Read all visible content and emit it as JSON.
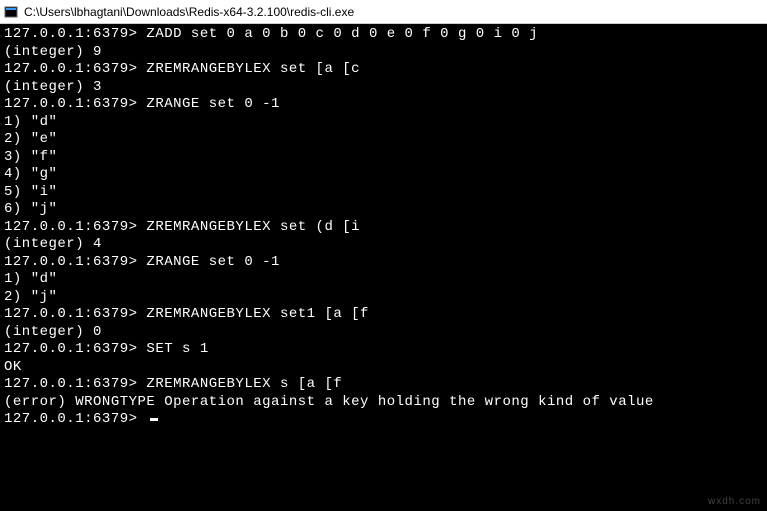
{
  "window": {
    "title": "C:\\Users\\lbhagtani\\Downloads\\Redis-x64-3.2.100\\redis-cli.exe"
  },
  "terminal": {
    "prompt": "127.0.0.1:6379>",
    "lines": [
      {
        "type": "cmd",
        "text": "ZADD set 0 a 0 b 0 c 0 d 0 e 0 f 0 g 0 i 0 j"
      },
      {
        "type": "out",
        "text": "(integer) 9"
      },
      {
        "type": "cmd",
        "text": "ZREMRANGEBYLEX set [a [c"
      },
      {
        "type": "out",
        "text": "(integer) 3"
      },
      {
        "type": "cmd",
        "text": "ZRANGE set 0 -1"
      },
      {
        "type": "out",
        "text": "1) \"d\""
      },
      {
        "type": "out",
        "text": "2) \"e\""
      },
      {
        "type": "out",
        "text": "3) \"f\""
      },
      {
        "type": "out",
        "text": "4) \"g\""
      },
      {
        "type": "out",
        "text": "5) \"i\""
      },
      {
        "type": "out",
        "text": "6) \"j\""
      },
      {
        "type": "cmd",
        "text": "ZREMRANGEBYLEX set (d [i"
      },
      {
        "type": "out",
        "text": "(integer) 4"
      },
      {
        "type": "cmd",
        "text": "ZRANGE set 0 -1"
      },
      {
        "type": "out",
        "text": "1) \"d\""
      },
      {
        "type": "out",
        "text": "2) \"j\""
      },
      {
        "type": "cmd",
        "text": "ZREMRANGEBYLEX set1 [a [f"
      },
      {
        "type": "out",
        "text": "(integer) 0"
      },
      {
        "type": "cmd",
        "text": "SET s 1"
      },
      {
        "type": "out",
        "text": "OK"
      },
      {
        "type": "cmd",
        "text": "ZREMRANGEBYLEX s [a [f"
      },
      {
        "type": "out",
        "text": "(error) WRONGTYPE Operation against a key holding the wrong kind of value"
      },
      {
        "type": "prompt-only",
        "text": ""
      }
    ]
  },
  "watermark": "wxdh.com"
}
